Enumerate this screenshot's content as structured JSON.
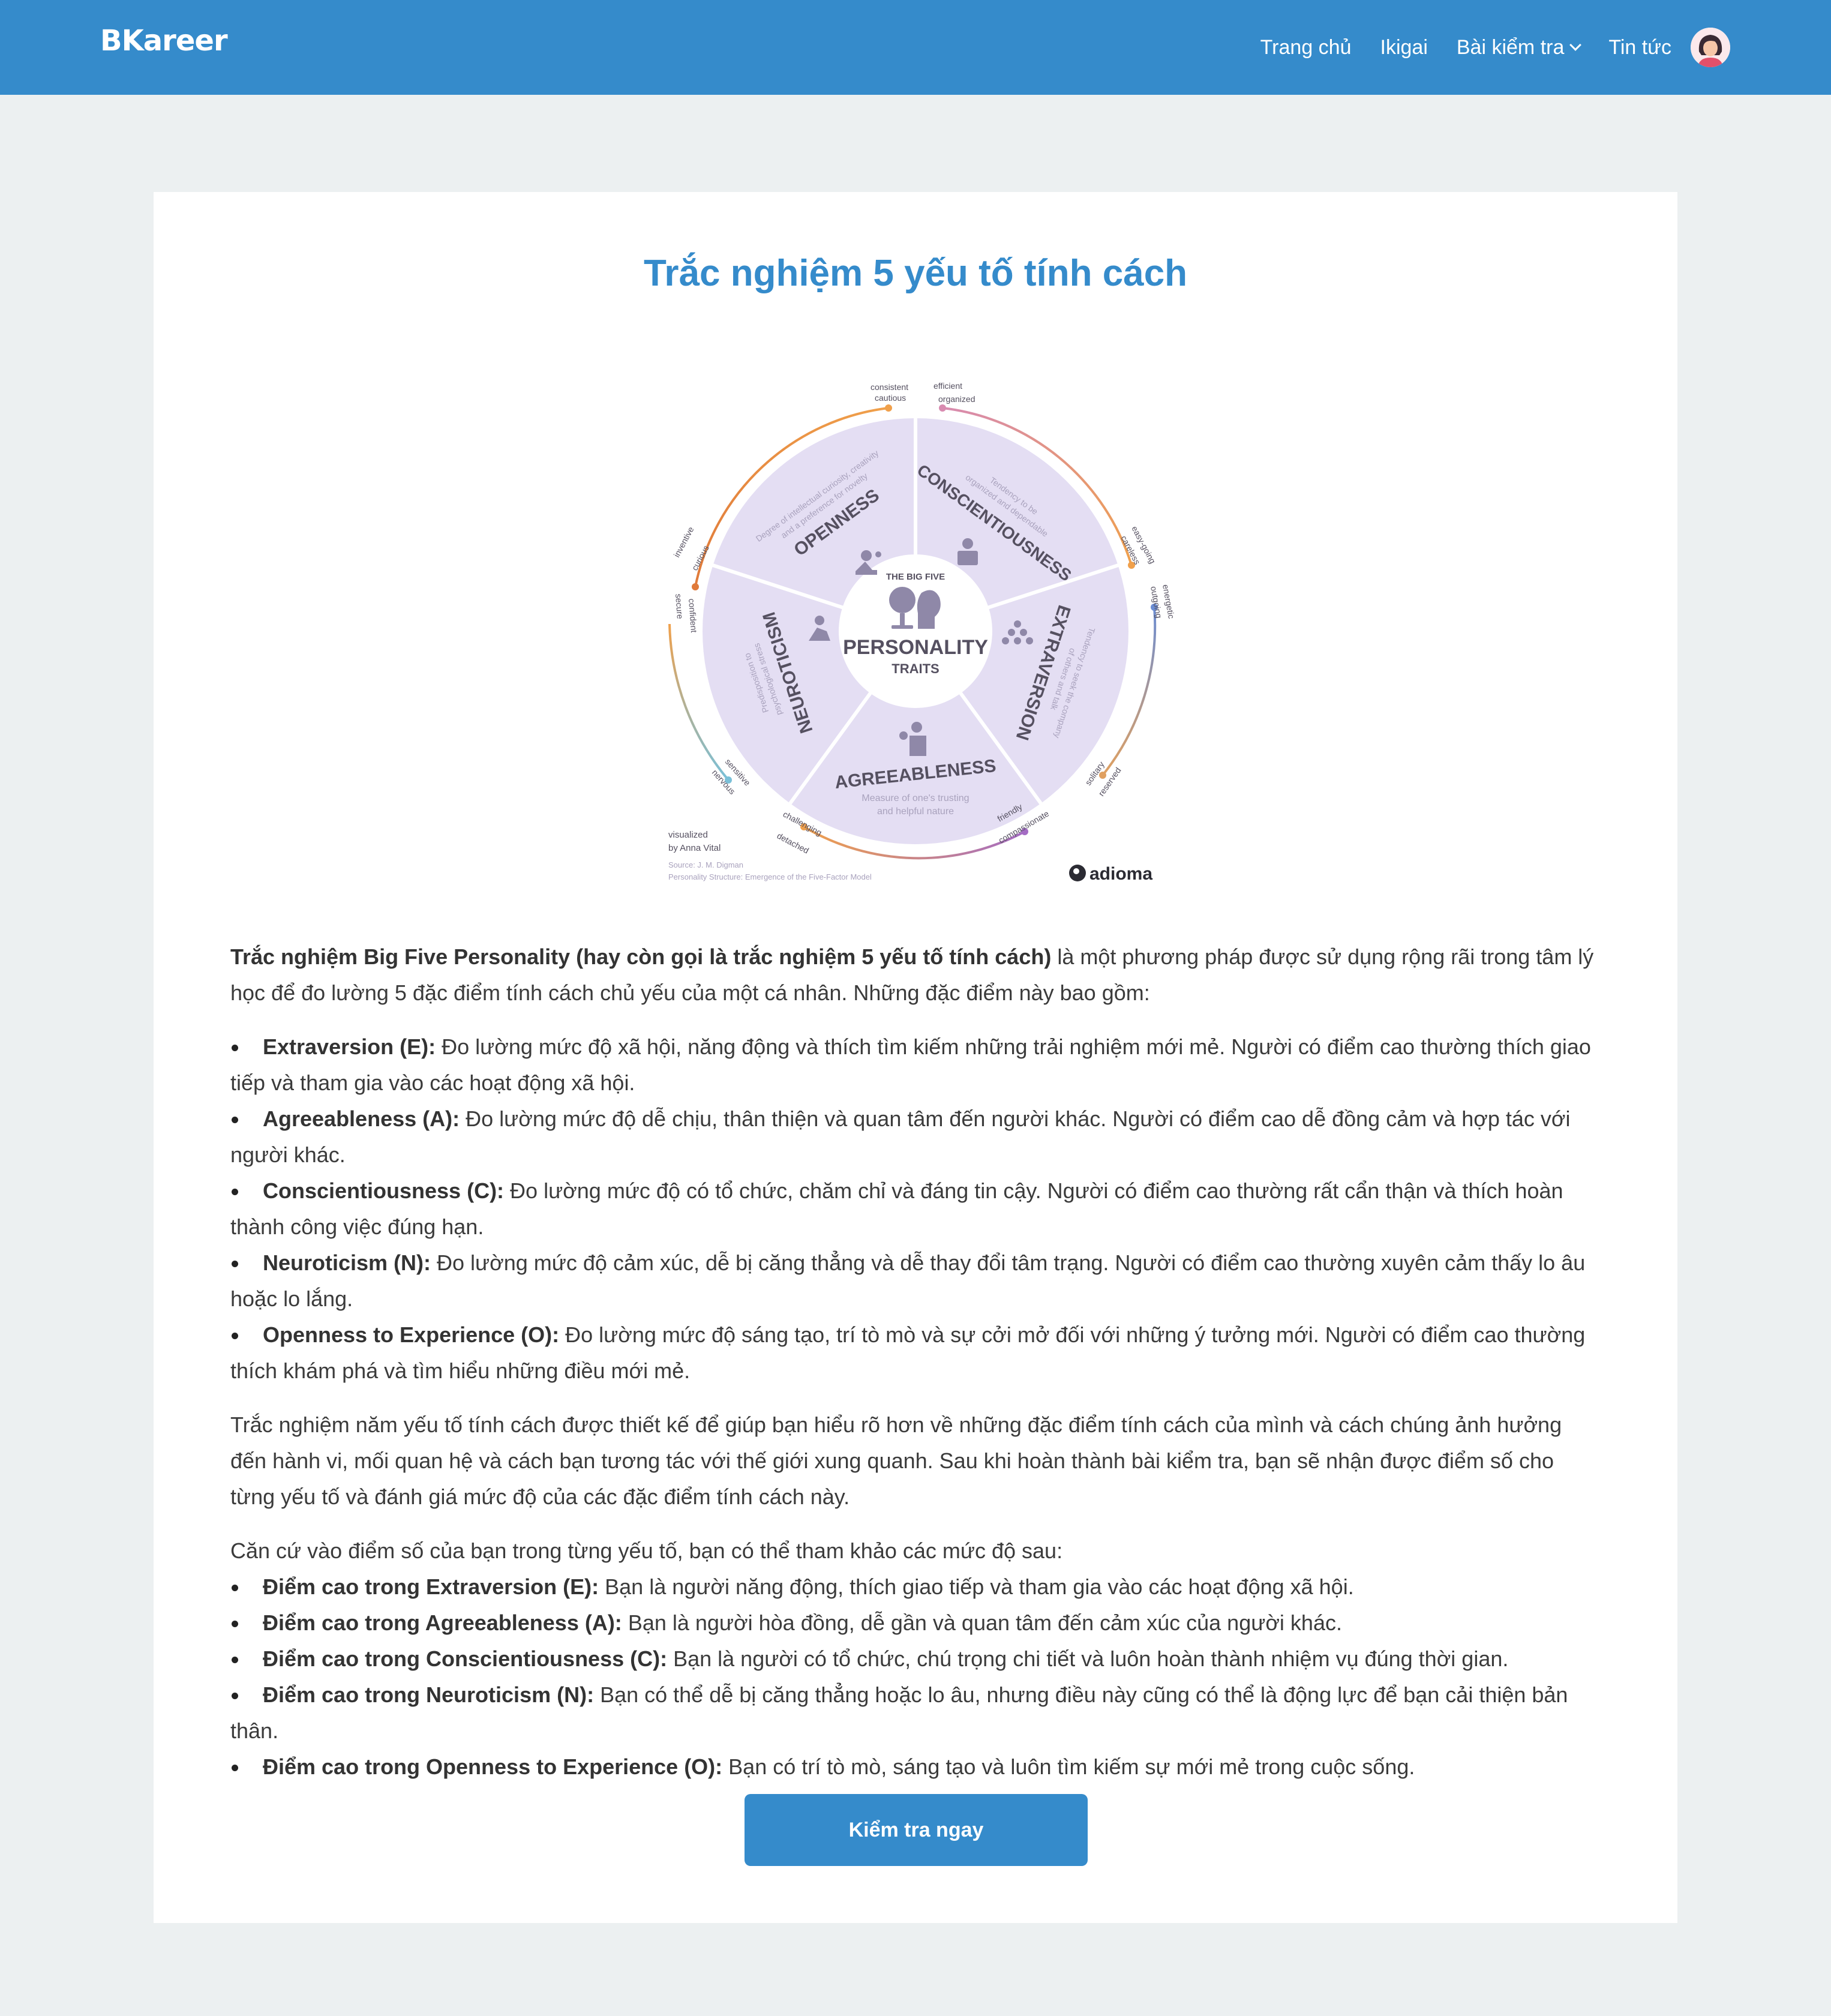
{
  "nav": {
    "brand": "BKareer",
    "links": [
      "Trang chủ",
      "Ikigai",
      "Bài kiểm tra",
      "Tin tức"
    ]
  },
  "page": {
    "title": "Trắc nghiệm 5 yếu tố tính cách",
    "cta": "Kiểm tra ngay"
  },
  "figure": {
    "center_top": "THE BIG FIVE",
    "center_main": "PERSONALITY",
    "center_sub": "TRAITS",
    "traits": [
      {
        "name": "OPENNESS",
        "desc1": "Degree of intellectual curiosity, creativity",
        "desc2": "and a preference for novelty",
        "low": [
          "inventive",
          "curious"
        ],
        "high": [
          "consistent",
          "cautious"
        ]
      },
      {
        "name": "CONSCIENTIOUSNESS",
        "desc1": "Tendency to be",
        "desc2": "organized and dependable",
        "low": [
          "efficient",
          "organized"
        ],
        "high": [
          "easy-going",
          "careless"
        ]
      },
      {
        "name": "EXTRAVERSION",
        "desc1": "Tendency to seek the company",
        "desc2": "of others and talk",
        "low": [
          "outgoing",
          "energetic"
        ],
        "high": [
          "solitary",
          "reserved"
        ]
      },
      {
        "name": "AGREEABLENESS",
        "desc1": "Measure of one's trusting",
        "desc2": "and helpful nature",
        "low": [
          "friendly",
          "compassionate"
        ],
        "high": [
          "challenging",
          "detached"
        ]
      },
      {
        "name": "NEUROTICISM",
        "desc1": "Predisposition to",
        "desc2": "psychological stress",
        "low": [
          "sensitive",
          "nervous"
        ],
        "high": [
          "secure",
          "confident"
        ]
      }
    ],
    "credit1": "visualized",
    "credit2": "by Anna Vital",
    "source1": "Source: J. M. Digman",
    "source2": "Personality Structure: Emergence of the Five-Factor Model",
    "brand": "adioma",
    "colors": {
      "wheel": "#e4def3",
      "center": "#ffffff",
      "ink": "#555060",
      "arc_orange": "#f0a04b",
      "arc_pink": "#d88bb0",
      "arc_blue": "#6c8ed4",
      "arc_purple": "#a46cc4"
    }
  },
  "content": {
    "intro_bold": "Trắc nghiệm Big Five Personality (hay còn gọi là trắc nghiệm 5 yếu tố tính cách)",
    "intro_rest": " là một phương pháp được sử dụng rộng rãi trong tâm lý học để đo lường 5 đặc điểm tính cách chủ yếu của một cá nhân. Những đặc điểm này bao gồm:",
    "traits": [
      {
        "label": "Extraversion (E):",
        "text": " Đo lường mức độ xã hội, năng động và thích tìm kiếm những trải nghiệm mới mẻ. Người có điểm cao thường thích giao tiếp và tham gia vào các hoạt động xã hội."
      },
      {
        "label": "Agreeableness (A):",
        "text": " Đo lường mức độ dễ chịu, thân thiện và quan tâm đến người khác. Người có điểm cao dễ đồng cảm và hợp tác với người khác."
      },
      {
        "label": "Conscientiousness (C):",
        "text": " Đo lường mức độ có tổ chức, chăm chỉ và đáng tin cậy. Người có điểm cao thường rất cẩn thận và thích hoàn thành công việc đúng hạn."
      },
      {
        "label": "Neuroticism (N):",
        "text": " Đo lường mức độ cảm xúc, dễ bị căng thẳng và dễ thay đổi tâm trạng. Người có điểm cao thường xuyên cảm thấy lo âu hoặc lo lắng."
      },
      {
        "label": "Openness to Experience (O):",
        "text": " Đo lường mức độ sáng tạo, trí tò mò và sự cởi mở đối với những ý tưởng mới. Người có điểm cao thường thích khám phá và tìm hiểu những điều mới mẻ."
      }
    ],
    "summary": "Trắc nghiệm năm yếu tố tính cách được thiết kế để giúp bạn hiểu rõ hơn về những đặc điểm tính cách của mình và cách chúng ảnh hưởng đến hành vi, mối quan hệ và cách bạn tương tác với thế giới xung quanh. Sau khi hoàn thành bài kiểm tra, bạn sẽ nhận được điểm số cho từng yếu tố và đánh giá mức độ của các đặc điểm tính cách này.",
    "levels_intro": "Căn cứ vào điểm số của bạn trong từng yếu tố, bạn có thể tham khảo các mức độ sau:",
    "levels": [
      {
        "label": "Điểm cao trong Extraversion (E):",
        "text": " Bạn là người năng động, thích giao tiếp và tham gia vào các hoạt động xã hội."
      },
      {
        "label": "Điểm cao trong Agreeableness (A):",
        "text": " Bạn là người hòa đồng, dễ gần và quan tâm đến cảm xúc của người khác."
      },
      {
        "label": "Điểm cao trong Conscientiousness (C):",
        "text": " Bạn là người có tổ chức, chú trọng chi tiết và luôn hoàn thành nhiệm vụ đúng thời gian."
      },
      {
        "label": "Điểm cao trong Neuroticism (N):",
        "text": " Bạn có thể dễ bị căng thẳng hoặc lo âu, nhưng điều này cũng có thể là động lực để bạn cải thiện bản thân."
      },
      {
        "label": "Điểm cao trong Openness to Experience (O):",
        "text": " Bạn có trí tò mò, sáng tạo và luôn tìm kiếm sự mới mẻ trong cuộc sống."
      }
    ]
  }
}
